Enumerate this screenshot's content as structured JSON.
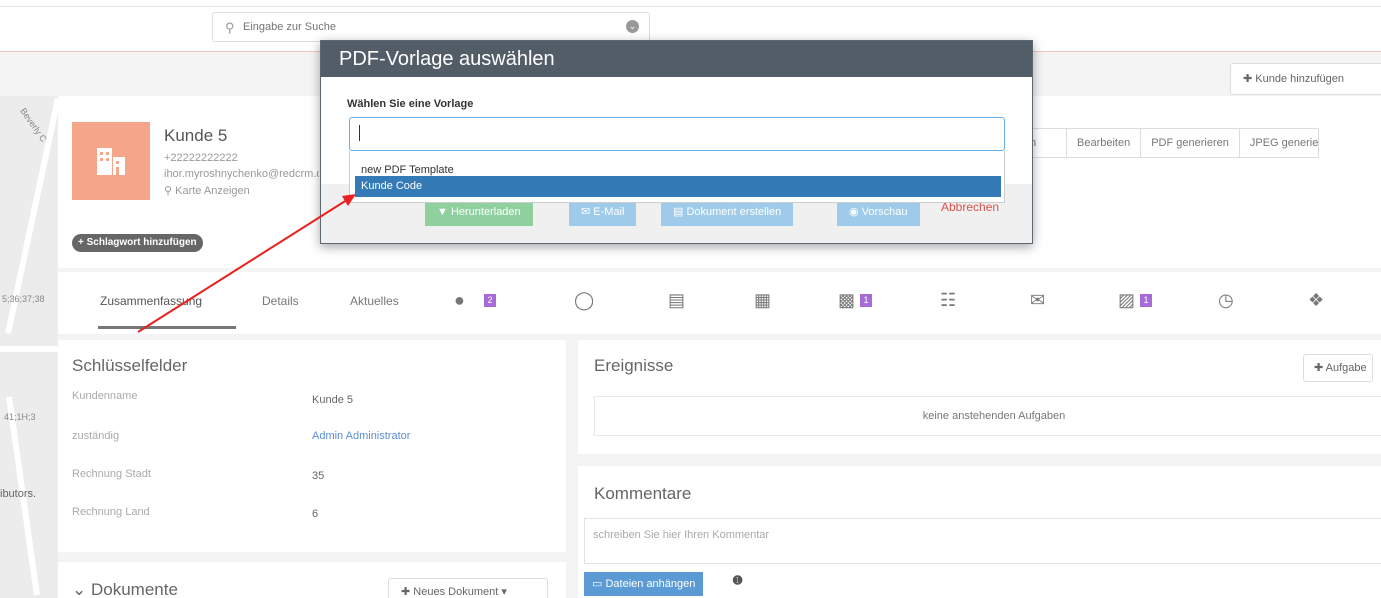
{
  "search": {
    "placeholder": "Eingabe zur Suche"
  },
  "header": {
    "add_customer": "Kunde hinzufügen"
  },
  "map": {
    "labels": [
      "Beverly C",
      "5;36;37;38",
      "41;1H;3",
      "ibutors."
    ]
  },
  "customer": {
    "name": "Kunde 5",
    "phone": "+22222222222",
    "email": "ihor.myroshnychenko@redcrm.de",
    "map_link": "Karte Anzeigen",
    "tag_button": "+ Schlagwort hinzufügen"
  },
  "actions": [
    "n",
    "Bearbeiten",
    "PDF generieren",
    "JPEG generieren"
  ],
  "tabs": {
    "items": [
      "Zusammenfassung",
      "Details",
      "Aktuelles"
    ],
    "badges": {
      "contacts": "2",
      "docs": "1",
      "files": "1"
    }
  },
  "key_fields": {
    "title": "Schlüsselfelder",
    "rows": [
      {
        "label": "Kundenname",
        "value": "Kunde 5"
      },
      {
        "label": "zuständig",
        "value": "Admin Administrator"
      },
      {
        "label": "Rechnung Stadt",
        "value": "35"
      },
      {
        "label": "Rechnung Land",
        "value": "6"
      }
    ]
  },
  "documents": {
    "title": "Dokumente",
    "new_button": "Neues Dokument"
  },
  "events": {
    "title": "Ereignisse",
    "add_task": "Aufgabe",
    "empty": "keine anstehenden Aufgaben"
  },
  "comments": {
    "title": "Kommentare",
    "placeholder": "schreiben Sie hier Ihren Kommentar",
    "attach": "Dateien anhängen"
  },
  "modal": {
    "title": "PDF-Vorlage auswählen",
    "label": "Wählen Sie eine Vorlage",
    "options": [
      "new PDF Template",
      "Kunde Code"
    ],
    "selected_index": 1,
    "buttons": {
      "download": "Herunterladen",
      "email": "E-Mail",
      "create_document": "Dokument erstellen",
      "preview": "Vorschau",
      "cancel": "Abbrechen"
    }
  },
  "colors": {
    "modal_header": "#525d67",
    "avatar": "#f4a58a",
    "selected_option": "#337ab7",
    "badge": "#a66bd6",
    "annotation_arrow": "#e8201f"
  }
}
